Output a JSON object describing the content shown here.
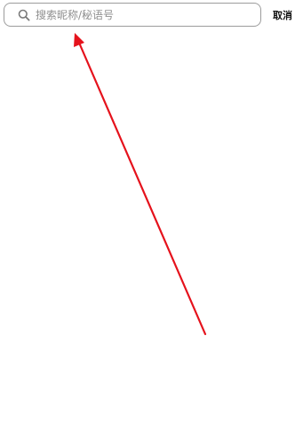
{
  "search": {
    "placeholder": "搜索昵称/秘语号",
    "value": ""
  },
  "header": {
    "cancel_label": "取消"
  },
  "icons": {
    "search": "search-icon"
  },
  "annotation": {
    "arrow_color": "#e5121c"
  }
}
